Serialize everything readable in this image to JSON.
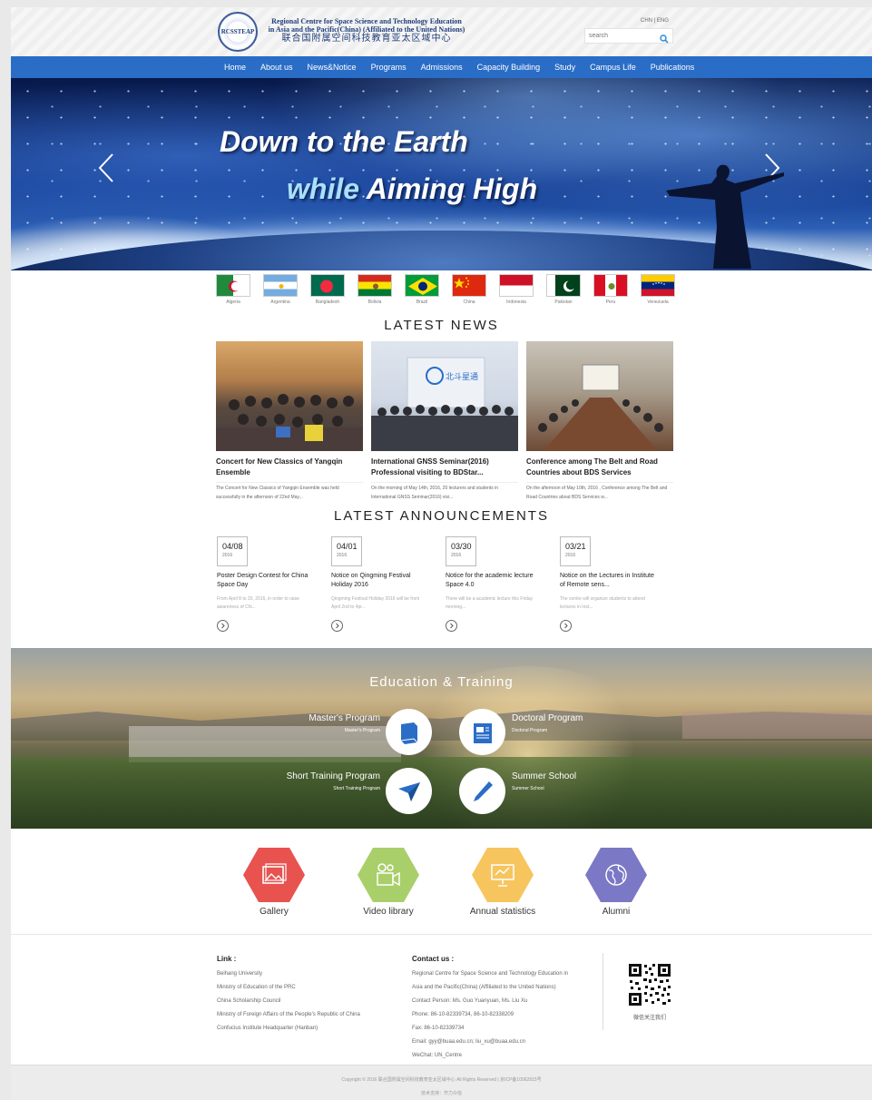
{
  "header": {
    "org_line1": "Regional Centre for Space Science and Technology Education",
    "org_line2": "in Asia and the Pacific(China) (Affiliated to the United Nations)",
    "org_cn": "联合国附属空间科技教育亚太区域中心",
    "logo_text": "RCSSTEAP",
    "lang_switch": "CHN | ENG",
    "search_placeholder": "search"
  },
  "nav": {
    "items": [
      "Home",
      "About us",
      "News&Notice",
      "Programs",
      "Admissions",
      "Capacity Building",
      "Study",
      "Campus Life",
      "Publications"
    ]
  },
  "banner": {
    "line1": "Down to the Earth",
    "line2_a": "while",
    "line2_b": "Aiming High"
  },
  "flags": [
    "Algeria",
    "Argentina",
    "Bangladesh",
    "Bolivia",
    "Brazil",
    "China",
    "Indonesia",
    "Pakistan",
    "Peru",
    "Venezuela"
  ],
  "news": {
    "title": "LATEST NEWS",
    "items": [
      {
        "title": "Concert for New Classics of Yangqin Ensemble",
        "desc": "The Concert for New Classics of Yangqin Ensemble was held successfully in the afternoon of 22nd May..."
      },
      {
        "title": "International GNSS Seminar(2016) Professional visiting to BDStar...",
        "desc": "On the morning of May 14th, 2016, 20 lecturers and students in International GNSS Seminar(2016) visi..."
      },
      {
        "title": "Conference among The Belt and Road Countries about BDS Services",
        "desc": "On the afternoon of May 10th, 2016 , Conference among The Belt and Road Countries about BDS Services w..."
      }
    ],
    "photo2_sign": "北斗星通"
  },
  "announcements": {
    "title": "LATEST ANNOUNCEMENTS",
    "items": [
      {
        "day": "04/08",
        "year": "2016",
        "title": "Poster Design Contest for China Space Day",
        "desc": "From April 8 to 20, 2016, in order to raise awareness of Chi..."
      },
      {
        "day": "04/01",
        "year": "2016",
        "title": "Notice on Qingming Festival Holiday 2016",
        "desc": "Qingming Festival Holiday 2016 will be from April 2nd to 4pr..."
      },
      {
        "day": "03/30",
        "year": "2016",
        "title": "Notice for the academic lecture Space 4.0",
        "desc": "There will be a academic lecture this Friday morning..."
      },
      {
        "day": "03/21",
        "year": "2016",
        "title": "Notice on the Lectures in Institute of Remote sens...",
        "desc": "The centre will organize students to attend lectures in Inst..."
      }
    ]
  },
  "education": {
    "title": "Education & Training",
    "programs": [
      {
        "name": "Master's Program",
        "sub": "Master's Program"
      },
      {
        "name": "Doctoral Program",
        "sub": "Doctoral Program"
      },
      {
        "name": "Short Training Program",
        "sub": "Short Training Program"
      },
      {
        "name": "Summer School",
        "sub": "Summer School"
      }
    ]
  },
  "quick_links": [
    {
      "label": "Gallery",
      "color": "#e8524f",
      "icon": "picture-icon"
    },
    {
      "label": "Video library",
      "color": "#a9cf6b",
      "icon": "video-camera-icon"
    },
    {
      "label": "Annual statistics",
      "color": "#f7c55e",
      "icon": "presentation-chart-icon"
    },
    {
      "label": "Alumni",
      "color": "#7b78c6",
      "icon": "globe-icon"
    }
  ],
  "footer": {
    "links_title": "Link :",
    "links": [
      "Beihang University",
      "Ministry of Education of the PRC",
      "China Scholarship Council",
      "Ministry of Foreign Affairs of the People's Republic of China",
      "Confucius Institute Headquarter (Hanban)"
    ],
    "contact_title": "Contact us :",
    "contact": [
      "Regional Centre for Space Science and Technology Education in",
      "Asia and the Pacific(China) (Affiliated to the United Nations)",
      "Contact Person: Ms. Guo Yuanyuan, Ms. Liu Xu",
      "Phone: 86-10-82339734, 86-10-82338209",
      "Fax: 86-10-82339734",
      "Email: gyy@buaa.edu.cn; liu_xu@buaa.edu.cn",
      "WeChat: UN_Centre"
    ],
    "qr_label": "微信关注我们",
    "copyright": "Copyright © 2016 联合国附属空间科技教育亚太区域中心 All Rights Reserved | 京ICP备10062815号",
    "tech": "技术支持：齐力众信"
  }
}
